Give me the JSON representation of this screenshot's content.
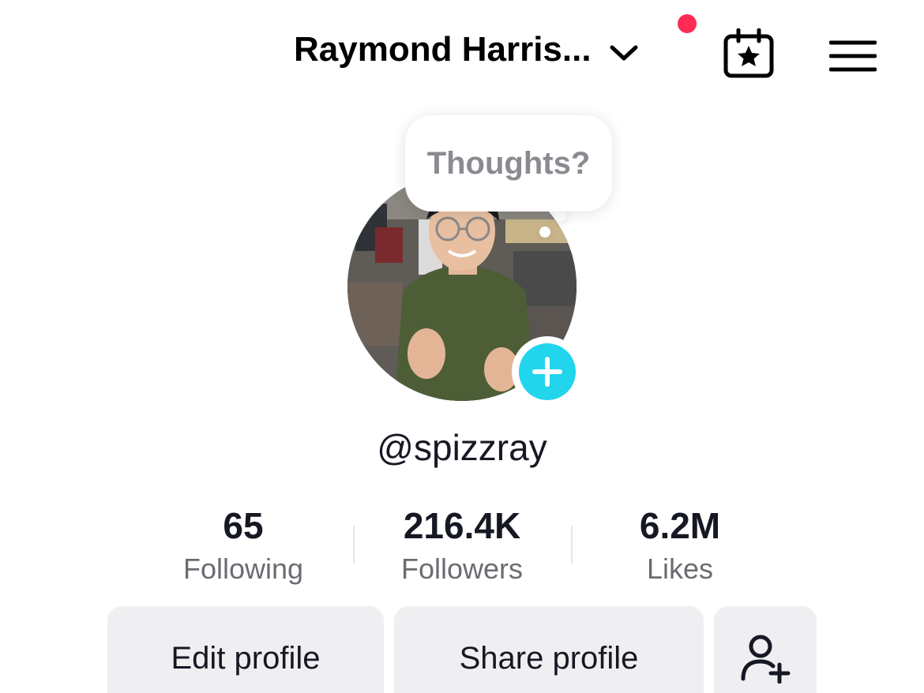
{
  "header": {
    "title": "Raymond Harris...",
    "notification_dot_color": "#fe2c55",
    "icons": [
      "chevron-down-icon",
      "creator-calendar-star-icon",
      "hamburger-menu-icon"
    ]
  },
  "profile": {
    "bubble_text": "Thoughts?",
    "username": "@spizzray",
    "add_badge_color": "#20d5ec"
  },
  "stats": [
    {
      "value": "65",
      "label": "Following"
    },
    {
      "value": "216.4K",
      "label": "Followers"
    },
    {
      "value": "6.2M",
      "label": "Likes"
    }
  ],
  "actions": {
    "edit_label": "Edit profile",
    "share_label": "Share profile",
    "add_friend_icon": "add-person-icon"
  }
}
